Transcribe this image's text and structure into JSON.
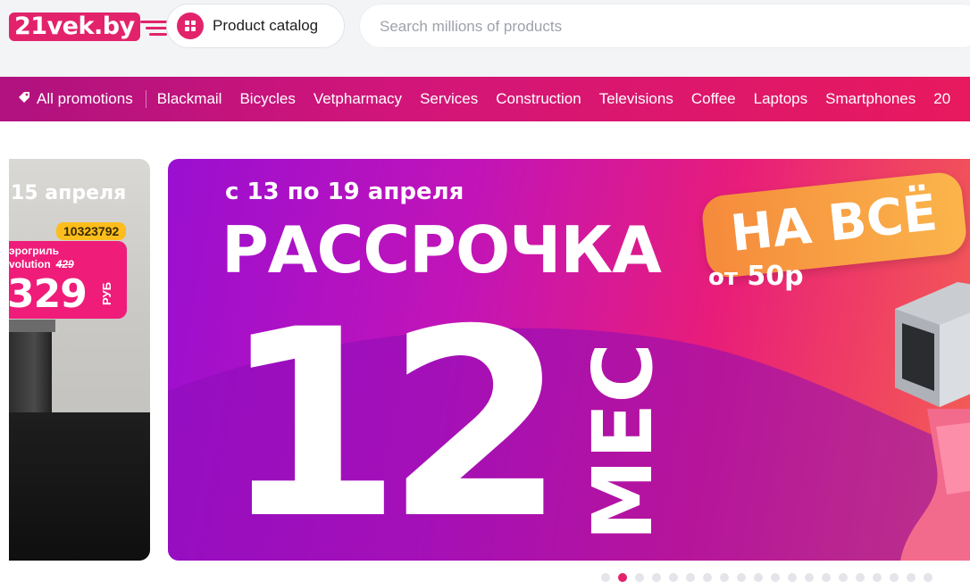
{
  "header": {
    "logo_text": "21vek.by",
    "catalog_label": "Product catalog",
    "search_placeholder": "Search millions of products"
  },
  "nav": {
    "promotions_label": "All promotions",
    "items": [
      "Blackmail",
      "Bicycles",
      "Vetpharmacy",
      "Services",
      "Construction",
      "Televisions",
      "Coffee",
      "Laptops",
      "Smartphones",
      "20"
    ]
  },
  "carousel": {
    "prev_slide": {
      "date": "15 апреля",
      "code": "10323792",
      "product_line1": "эрогриль",
      "product_line2": "volution",
      "old_price": "429",
      "price": "329",
      "currency": "РУБ"
    },
    "main_slide": {
      "date": "с 13 по 19 апреля",
      "title": "РАССРОЧКА",
      "badge": "НА ВСЁ",
      "from_prefix": "от",
      "from_value": "50р",
      "months_number": "12",
      "months_unit": "МЕС"
    },
    "dots_count": 20,
    "active_dot_index": 1
  },
  "colors": {
    "brand": "#e2236b",
    "nav_gradient_start": "#b0127f",
    "nav_gradient_end": "#e8195e",
    "badge_orange": "#f58a3c",
    "code_yellow": "#fcbd1d"
  }
}
